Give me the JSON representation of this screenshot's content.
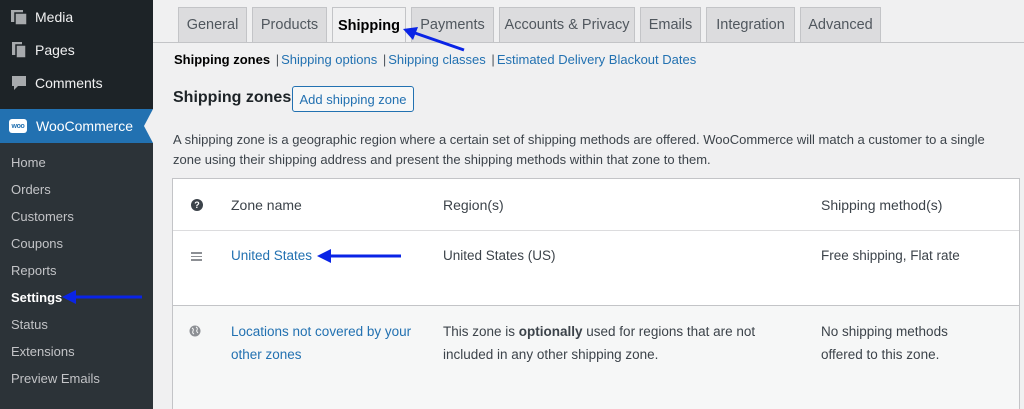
{
  "sidebar": {
    "top_items": [
      {
        "label": "Media",
        "icon": "media-icon"
      },
      {
        "label": "Pages",
        "icon": "pages-icon"
      },
      {
        "label": "Comments",
        "icon": "comments-icon"
      }
    ],
    "active": {
      "label": "WooCommerce",
      "badge": "woo"
    },
    "submenu": [
      {
        "label": "Home"
      },
      {
        "label": "Orders"
      },
      {
        "label": "Customers"
      },
      {
        "label": "Coupons"
      },
      {
        "label": "Reports"
      },
      {
        "label": "Settings",
        "current": true
      },
      {
        "label": "Status"
      },
      {
        "label": "Extensions"
      },
      {
        "label": "Preview Emails"
      }
    ]
  },
  "tabs": [
    {
      "label": "General"
    },
    {
      "label": "Products"
    },
    {
      "label": "Shipping",
      "active": true
    },
    {
      "label": "Payments"
    },
    {
      "label": "Accounts & Privacy"
    },
    {
      "label": "Emails"
    },
    {
      "label": "Integration"
    },
    {
      "label": "Advanced"
    }
  ],
  "subsub": {
    "current": "Shipping zones",
    "links": [
      "Shipping options",
      "Shipping classes",
      "Estimated Delivery Blackout Dates"
    ],
    "separator": "|"
  },
  "heading": {
    "title": "Shipping zones",
    "add_button": "Add shipping zone"
  },
  "description": "A shipping zone is a geographic region where a certain set of shipping methods are offered. WooCommerce will match a customer to a single zone using their shipping address and present the shipping methods within that zone to them.",
  "table": {
    "headers": {
      "help": "?",
      "zone_name": "Zone name",
      "regions": "Region(s)",
      "methods": "Shipping method(s)"
    },
    "zones": [
      {
        "name": "United States",
        "regions": "United States (US)",
        "methods": "Free shipping, Flat rate"
      }
    ],
    "rest_of_world": {
      "name": "Locations not covered by your other zones",
      "regions_prefix": "This zone is ",
      "regions_bold": "optionally",
      "regions_suffix": " used for regions that are not included in any other shipping zone.",
      "methods": "No shipping methods offered to this zone."
    }
  },
  "colors": {
    "sidebar_bg": "#1d2327",
    "submenu_bg": "#2c3338",
    "accent": "#2271b1",
    "annotation_arrow": "#0a24e6"
  }
}
